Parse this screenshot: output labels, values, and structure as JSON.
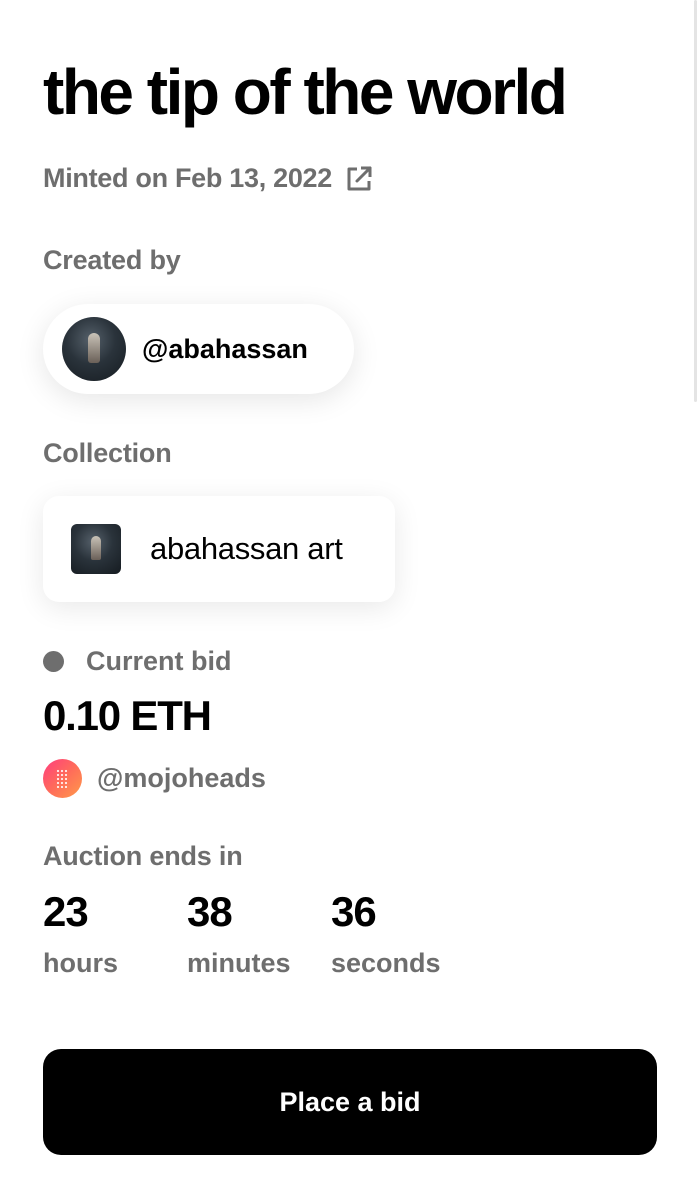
{
  "artwork": {
    "title": "the tip of the world",
    "minted_text": "Minted on Feb 13, 2022",
    "external_link_icon": "external-link-icon"
  },
  "creator": {
    "section_label": "Created by",
    "username": "@abahassan"
  },
  "collection": {
    "section_label": "Collection",
    "name": "abahassan art"
  },
  "auction": {
    "current_bid_label": "Current bid",
    "status_color": "#6e6e6e",
    "current_bid_amount": "0.10 ETH",
    "bidder_username": "@mojoheads",
    "ends_label": "Auction ends in",
    "countdown": [
      {
        "value": "23",
        "unit": "hours"
      },
      {
        "value": "38",
        "unit": "minutes"
      },
      {
        "value": "36",
        "unit": "seconds"
      }
    ]
  },
  "actions": {
    "place_bid_label": "Place a bid"
  },
  "colors": {
    "primary_text": "#000000",
    "secondary_text": "#6e6e6e",
    "button_bg": "#000000",
    "button_text": "#ffffff",
    "bidder_avatar_gradient": [
      "#ff3d7f",
      "#ff9a4a"
    ]
  }
}
